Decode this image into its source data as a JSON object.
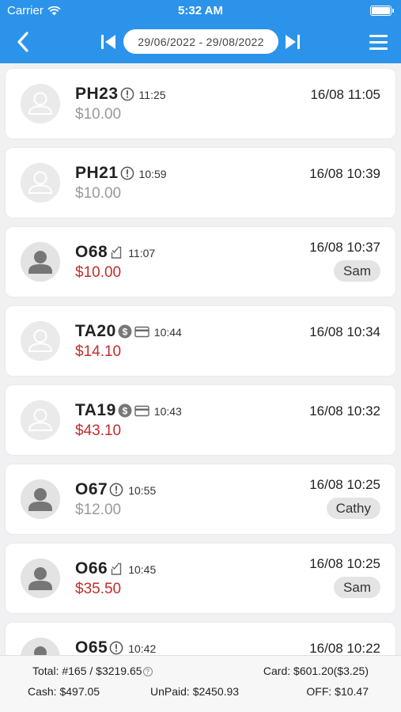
{
  "status_bar": {
    "carrier": "Carrier",
    "time": "5:32 AM"
  },
  "header": {
    "date_range": "29/06/2022 - 29/08/2022"
  },
  "colors": {
    "accent": "#2c93ea",
    "unpaid": "#c22d2d",
    "paid": "#9a9a9a"
  },
  "orders": [
    {
      "id": "PH23",
      "status_icons": [
        "alert-icon"
      ],
      "time": "11:25",
      "amount": "$10.00",
      "amount_state": "paid",
      "stamp": "16/08 11:05",
      "staff": "",
      "avatar": "light"
    },
    {
      "id": "PH21",
      "status_icons": [
        "alert-icon"
      ],
      "time": "10:59",
      "amount": "$10.00",
      "amount_state": "paid",
      "stamp": "16/08 10:39",
      "staff": "",
      "avatar": "light"
    },
    {
      "id": "O68",
      "status_icons": [
        "checklist-icon"
      ],
      "time": "11:07",
      "amount": "$10.00",
      "amount_state": "unpaid",
      "stamp": "16/08 10:37",
      "staff": "Sam",
      "avatar": "dark"
    },
    {
      "id": "TA20",
      "status_icons": [
        "dollar-icon",
        "card-icon"
      ],
      "time": "10:44",
      "amount": "$14.10",
      "amount_state": "unpaid",
      "stamp": "16/08 10:34",
      "staff": "",
      "avatar": "light"
    },
    {
      "id": "TA19",
      "status_icons": [
        "dollar-icon",
        "card-icon"
      ],
      "time": "10:43",
      "amount": "$43.10",
      "amount_state": "unpaid",
      "stamp": "16/08 10:32",
      "staff": "",
      "avatar": "light"
    },
    {
      "id": "O67",
      "status_icons": [
        "alert-icon"
      ],
      "time": "10:55",
      "amount": "$12.00",
      "amount_state": "paid",
      "stamp": "16/08 10:25",
      "staff": "Cathy",
      "avatar": "dark"
    },
    {
      "id": "O66",
      "status_icons": [
        "checklist-icon"
      ],
      "time": "10:45",
      "amount": "$35.50",
      "amount_state": "unpaid",
      "stamp": "16/08 10:25",
      "staff": "Sam",
      "avatar": "dark"
    },
    {
      "id": "O65",
      "status_icons": [
        "alert-icon"
      ],
      "time": "10:42",
      "amount": "",
      "amount_state": "paid",
      "stamp": "16/08 10:22",
      "staff": "",
      "avatar": "dark"
    }
  ],
  "footer": {
    "total": "Total:  #165 / $3219.65",
    "card": "Card:  $601.20($3.25)",
    "cash": "Cash: $497.05",
    "unpaid": "UnPaid:  $2450.93",
    "off": "OFF:  $10.47"
  }
}
